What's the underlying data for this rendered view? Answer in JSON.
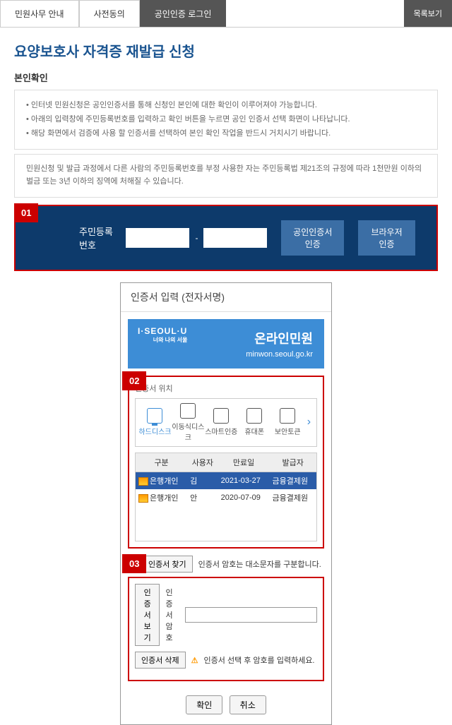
{
  "tabs": {
    "tab1": "민원사무 안내",
    "tab2": "사전동의",
    "tab3": "공인인증 로그인"
  },
  "list_button": "목록보기",
  "page_title": "요양보호사 자격증 재발급 신청",
  "section_label": "본인확인",
  "info_list": {
    "i1": "인터넷 민원신청은 공인인증서를 통해 신청인 본인에 대한 확인이 이루어져야 가능합니다.",
    "i2": "아래의 입력창에 주민등록번호를 입력하고 확인 버튼을 누르면 공인 인증서 선택 화면이 나타납니다.",
    "i3": "해당 화면에서 검증에 사용 할 인증서를 선택하여 본인 확인 작업을 반드시 거치시기 바랍니다."
  },
  "warning_text": "민원신청 및 발급 과정에서 다른 사람의 주민등록번호를 부정 사용한 자는 주민등록법 제21조의 규정에 따라 1천만원 이하의 벌금 또는 3년 이하의 징역에 처해질 수 있습니다.",
  "steps": {
    "s1": "01",
    "s2": "02",
    "s3": "03"
  },
  "rrn": {
    "label": "주민등록번호",
    "btn_cert": "공인인증서 인증",
    "btn_browser": "브라우저 인증"
  },
  "cert": {
    "dialog_title": "인증서 입력 (전자서명)",
    "banner_logo": "I·SEOUL·U",
    "banner_logo_sub": "너와 나의 서울",
    "banner_main": "온라인민원",
    "banner_sub": "minwon.seoul.go.kr",
    "loc_label": "인증서 위치",
    "loc": {
      "hdd": "하드디스크",
      "removable": "이동식디스크",
      "smartcert": "스마트인증",
      "phone": "휴대폰",
      "token": "보안토큰"
    },
    "table": {
      "h1": "구분",
      "h2": "사용자",
      "h3": "만료일",
      "h4": "발급자",
      "r1c1": "은행개인",
      "r1c2": "김",
      "r1c3": "2021-03-27",
      "r1c4": "금융결제원",
      "r2c1": "은행개인",
      "r2c2": "안",
      "r2c3": "2020-07-09",
      "r2c4": "금융결제원"
    },
    "find_btn": "인증서 찾기",
    "find_note": "인증서 암호는 대소문자를 구분합니다.",
    "view_btn": "인증서 보기",
    "pw_label": "인증서 암호",
    "delete_btn": "인증서 삭제",
    "delete_note": "인증서 선택 후 암호를 입력하세요.",
    "ok": "확인",
    "cancel": "취소"
  }
}
